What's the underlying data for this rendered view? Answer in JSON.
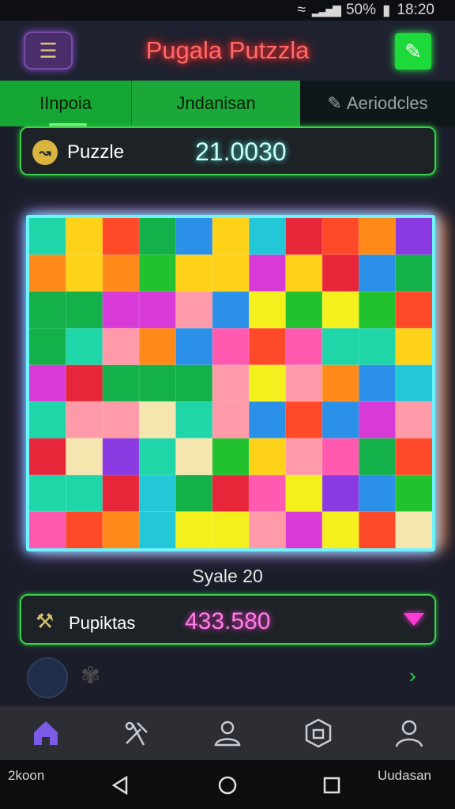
{
  "status_bar": {
    "battery": "50%",
    "time": "18:20"
  },
  "header": {
    "title": "Pugala Putzzla"
  },
  "tabs": [
    {
      "label": "IInpoia",
      "icon": ""
    },
    {
      "label": "Jndanisan",
      "icon": ""
    },
    {
      "label": "Aeriodcles",
      "icon": "edit-icon"
    }
  ],
  "score": {
    "label": "Puzzle",
    "value": "21.0030"
  },
  "board": {
    "rows": 9,
    "cols": 11,
    "palette": [
      "#e8263a",
      "#ff4a2a",
      "#ff8a1a",
      "#ffd21a",
      "#f4f01e",
      "#21c22e",
      "#14b04a",
      "#1fd6a8",
      "#23c8d8",
      "#2a90e8",
      "#8a3ae0",
      "#d83ad8",
      "#ff5ab0",
      "#ff9aa8",
      "#f5e6b0"
    ]
  },
  "level": {
    "text": "Syale 20"
  },
  "points": {
    "label": "Pupiktas",
    "value": "433.580"
  },
  "bottom_nav": [
    "home-icon",
    "tools-icon",
    "profile-icon",
    "badge-icon",
    "account-icon"
  ],
  "system_bar": {
    "left_text": "2koon",
    "right_text": "Uudasan"
  },
  "colors": {
    "accent_green": "#2ad040",
    "neon_cyan": "#6ff4ff",
    "neon_pink": "#ff3ad6",
    "title_red": "#ff4a4a"
  }
}
